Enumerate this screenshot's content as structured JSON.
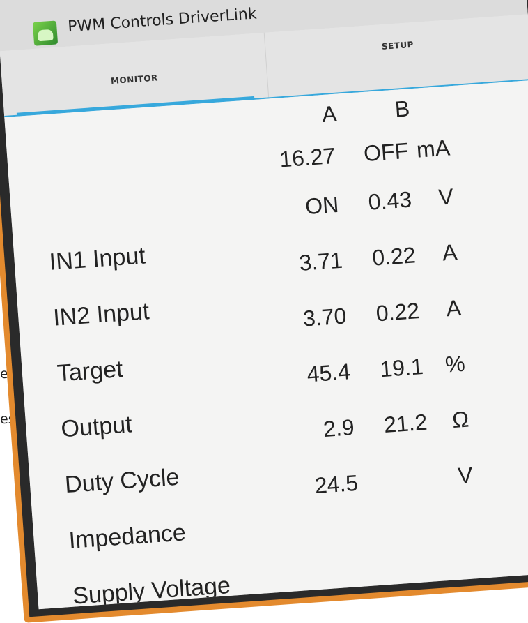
{
  "background_text": {
    "line1": "e",
    "line2": "es"
  },
  "app": {
    "title": "PWM Controls DriverLink",
    "icon": "app-logo-icon"
  },
  "tabs": [
    {
      "label": "MONITOR",
      "selected": true
    },
    {
      "label": "SETUP",
      "selected": false
    }
  ],
  "columns": {
    "a": "A",
    "b": "B"
  },
  "rows": [
    {
      "label": "",
      "a": "16.27",
      "b": "OFF",
      "unit": "mA"
    },
    {
      "label": "IN1 Input",
      "a": "ON",
      "b": "0.43",
      "unit": "V"
    },
    {
      "label": "IN2 Input",
      "a": "3.71",
      "b": "0.22",
      "unit": "A"
    },
    {
      "label": "Target",
      "a": "3.70",
      "b": "0.22",
      "unit": "A"
    },
    {
      "label": "Output",
      "a": "45.4",
      "b": "19.1",
      "unit": "%"
    },
    {
      "label": "Duty Cycle",
      "a": "2.9",
      "b": "21.2",
      "unit": "Ω"
    },
    {
      "label": "Impedance",
      "a": "24.5",
      "b": "",
      "unit": "V"
    },
    {
      "label": "Supply Voltage",
      "a": "",
      "b": "",
      "unit": ""
    }
  ],
  "colors": {
    "device_frame": "#e38a2e",
    "accent": "#37a8dc",
    "screen_bg": "#f4f4f3"
  }
}
